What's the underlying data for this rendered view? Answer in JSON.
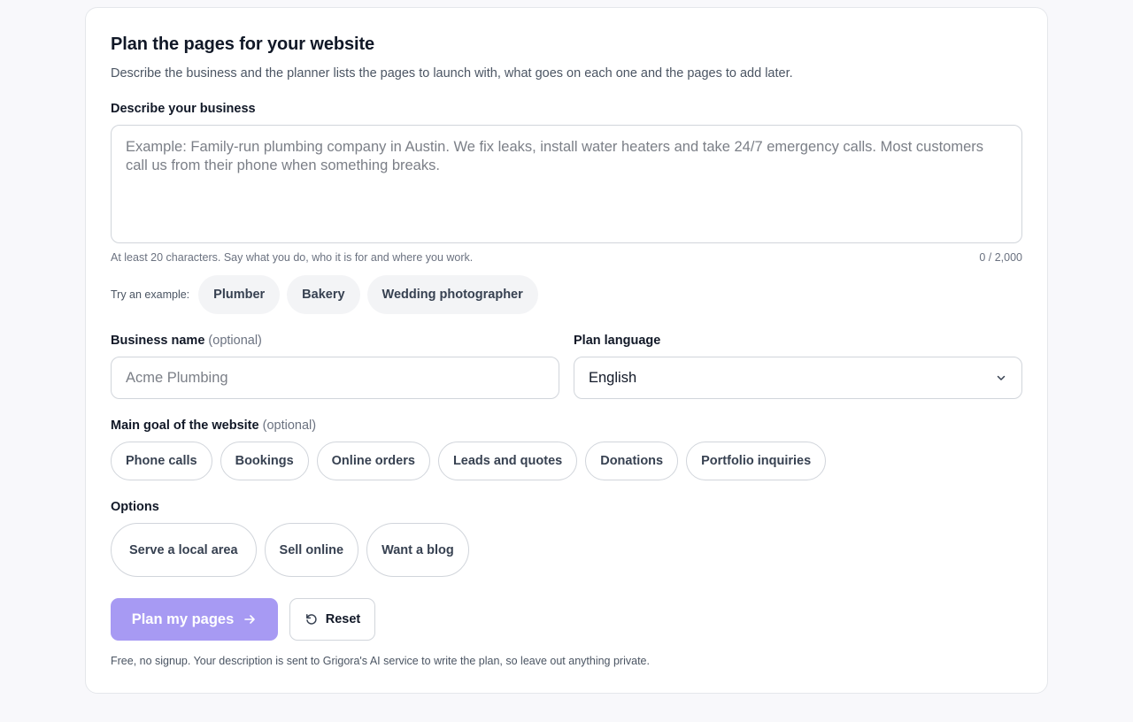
{
  "header": {
    "title": "Plan the pages for your website",
    "subtitle": "Describe the business and the planner lists the pages to launch with, what goes on each one and the pages to add later."
  },
  "description": {
    "label": "Describe your business",
    "value": "",
    "placeholder": "Example: Family-run plumbing company in Austin. We fix leaks, install water heaters and take 24/7 emergency calls. Most customers call us from their phone when something breaks.",
    "hint": "At least 20 characters. Say what you do, who it is for and where you work.",
    "counter": "0 / 2,000"
  },
  "examples": {
    "label": "Try an example:",
    "items": [
      "Plumber",
      "Bakery",
      "Wedding photographer"
    ]
  },
  "business_name": {
    "label": "Business name",
    "optional": "(optional)",
    "value": "",
    "placeholder": "Acme Plumbing"
  },
  "plan_language": {
    "label": "Plan language",
    "selected": "English"
  },
  "goal": {
    "label": "Main goal of the website",
    "optional": "(optional)",
    "items": [
      "Phone calls",
      "Bookings",
      "Online orders",
      "Leads and quotes",
      "Donations",
      "Portfolio inquiries"
    ]
  },
  "options": {
    "label": "Options",
    "items": [
      "Serve a local area",
      "Sell online",
      "Want a blog"
    ]
  },
  "actions": {
    "primary_label": "Plan my pages",
    "reset_label": "Reset"
  },
  "footnote": "Free, no signup. Your description is sent to Grigora's AI service to write the plan, so leave out anything private.",
  "colors": {
    "primary_disabled": "#a79af3",
    "border": "#d1d5db",
    "chip_bg": "#f3f4f6",
    "page_bg": "#f8f8fb"
  },
  "icons": {
    "select_chevron": "chevron-down-icon",
    "primary_arrow": "arrow-right-icon",
    "reset": "reset-icon"
  }
}
